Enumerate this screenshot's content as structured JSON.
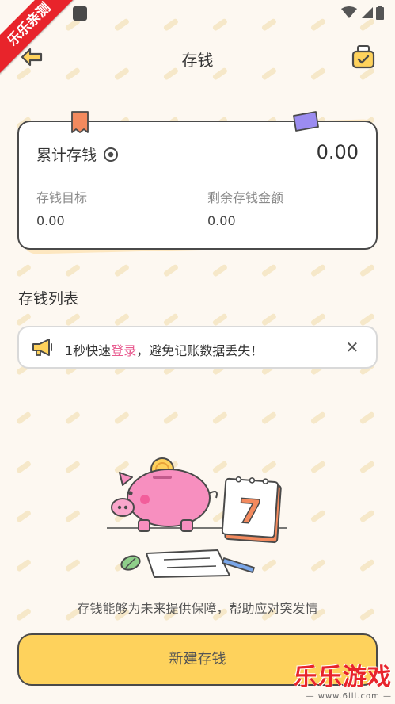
{
  "watermark": {
    "ribbon": "乐乐亲测",
    "brand": "乐乐游戏",
    "site": "— www.6lll.com —"
  },
  "nav": {
    "title": "存钱"
  },
  "summary": {
    "title": "累计存钱",
    "total": "0.00",
    "goal_label": "存钱目标",
    "goal_value": "0.00",
    "remaining_label": "剩余存钱金额",
    "remaining_value": "0.00"
  },
  "list": {
    "title": "存钱列表"
  },
  "notice": {
    "prefix": "1秒快速",
    "link": "登录",
    "suffix": "，避免记账数据丢失！",
    "close": "✕"
  },
  "empty": {
    "slogan": "存钱能够为未来提供保障，帮助应对突发情"
  },
  "calendar_number": "7",
  "actions": {
    "new": "新建存钱"
  },
  "colors": {
    "accent": "#fed25c",
    "link": "#e85a8f",
    "background": "#fdf8f1",
    "pig": "#f78fbf"
  },
  "icons": [
    "back-arrow-icon",
    "calendar-check-icon",
    "eye-icon",
    "megaphone-icon",
    "close-icon",
    "wifi-icon",
    "signal-icon",
    "battery-icon"
  ]
}
